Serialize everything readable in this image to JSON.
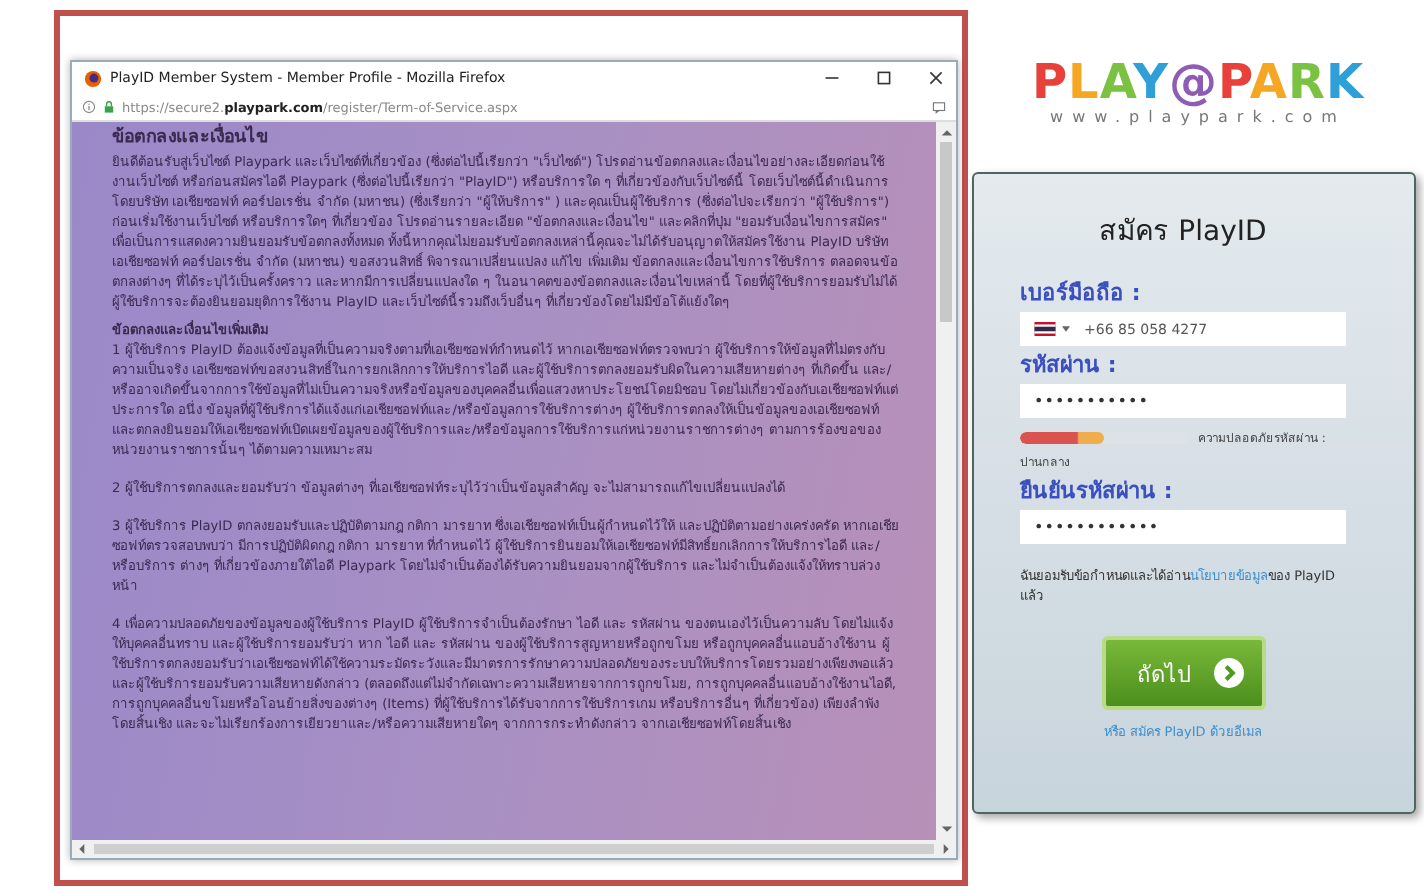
{
  "popup_window": {
    "title": "PlayID Member System - Member Profile - Mozilla Firefox",
    "url": "https://secure2.**playpark.com**/register/Term-of-Service.aspx",
    "terms": {
      "heading": "ข้อตกลงและเงื่อนไข",
      "intro": "ยินดีต้อนรับสู่เว็บไซต์ Playpark และเว็บไซต์ที่เกี่ยวข้อง (ซึ่งต่อไปนี้เรียกว่า \"เว็บไซต์\") โปรดอ่านข้อตกลงและเงื่อนไขอย่างละเอียดก่อนใช้งานเว็บไซต์ หรือก่อนสมัครไอดี Playpark (ซึ่งต่อไปนี้เรียกว่า \"PlayID\") หรือบริการใด ๆ ที่เกี่ยวข้องกับเว็บไซต์นี้ โดยเว็บไซต์นี้ดำเนินการโดยบริษัท เอเชียซอฟท์ คอร์ปอเรชั่น จำกัด (มหาชน) (ซึ่งเรียกว่า \"ผู้ให้บริการ\" ) และคุณเป็นผู้ใช้บริการ (ซึ่งต่อไปจะเรียกว่า \"ผู้ใช้บริการ\") ก่อนเริ่มใช้งานเว็บไซต์ หรือบริการใดๆ ที่เกี่ยวข้อง โปรดอ่านรายละเอียด \"ข้อตกลงและเงื่อนไข\" และคลิกที่ปุ่ม \"ยอมรับเงื่อนไขการสมัคร\" เพื่อเป็นการแสดงความยินยอมรับข้อตกลงทั้งหมด ทั้งนี้หากคุณไม่ยอมรับข้อตกลงเหล่านี้คุณจะไม่ได้รับอนุญาตให้สมัครใช้งาน PlayID บริษัท เอเชียซอฟท์ คอร์ปอเรชั่น จำกัด (มหาชน) ขอสงวนสิทธิ์ พิจารณาเปลี่ยนแปลง แก้ไข เพิ่มเติม ข้อตกลงและเงื่อนไขการใช้บริการ ตลอดจนข้อตกลงต่างๆ ที่ได้ระบุไว้เป็นครั้งคราว และหากมีการเปลี่ยนแปลงใด ๆ ในอนาคตของข้อตกลงและเงื่อนไขเหล่านี้ โดยที่ผู้ใช้บริการยอมรับไม่ได้ ผู้ใช้บริการจะต้องยินยอมยุติการใช้งาน PlayID และเว็บไซต์นี้รวมถึงเว็บอื่นๆ ที่เกี่ยวข้องโดยไม่มีข้อโต้แย้งใดๆ",
      "subheading": "ข้อตกลงและเงื่อนไขเพิ่มเติม",
      "clauses": [
        "1 ผู้ใช้บริการ PlayID ต้องแจ้งข้อมูลที่เป็นความจริงตามที่เอเชียซอฟท์กำหนดไว้ หากเอเชียซอฟท์ตรวจพบว่า ผู้ใช้บริการให้ข้อมูลที่ไม่ตรงกับความเป็นจริง เอเชียซอฟท์ขอสงวนสิทธิ์ในการยกเลิกการให้บริการไอดี และผู้ใช้บริการตกลงยอมรับผิดในความเสียหายต่างๆ ที่เกิดขึ้น และ/หรืออาจเกิดขึ้นจากการใช้ข้อมูลที่ไม่เป็นความจริงหรือข้อมูลของบุคคลอื่นเพื่อแสวงหาประโยชน์โดยมิชอบ โดยไม่เกี่ยวข้องกับเอเชียซอฟท์แต่ประการใด อนึ่ง ข้อมูลที่ผู้ใช้บริการได้แจ้งแก่เอเชียซอฟท์และ/หรือข้อมูลการใช้บริการต่างๆ ผู้ใช้บริการตกลงให้เป็นข้อมูลของเอเชียซอฟท์และตกลงยินยอมให้เอเชียซอฟท์เปิดเผยข้อมูลของผู้ใช้บริการและ/หรือข้อมูลการใช้บริการแก่หน่วยงานราชการต่างๆ ตามการร้องขอของหน่วยงานราชการนั้นๆ ได้ตามความเหมาะสม",
        "2 ผู้ใช้บริการตกลงและยอมรับว่า ข้อมูลต่างๆ ที่เอเชียซอฟท์ระบุไว้ว่าเป็นข้อมูลสำคัญ จะไม่สามารถแก้ไขเปลี่ยนแปลงได้",
        "3 ผู้ใช้บริการ PlayID ตกลงยอมรับและปฏิบัติตามกฎ กติกา มารยาท ซึ่งเอเชียซอฟท์เป็นผู้กำหนดไว้ให้ และปฏิบัติตามอย่างเคร่งครัด หากเอเชียซอฟท์ตรวจสอบพบว่า มีการปฏิบัติผิดกฎ กติกา มารยาท ที่กำหนดไว้ ผู้ใช้บริการยินยอมให้เอเชียซอฟท์มีสิทธิ์ยกเลิกการให้บริการไอดี และ/หรือบริการ ต่างๆ ที่เกี่ยวข้องภายใต้ไอดี Playpark โดยไม่จำเป็นต้องได้รับความยินยอมจากผู้ใช้บริการ และไม่จำเป็นต้องแจ้งให้ทราบล่วงหน้า",
        "4 เพื่อความปลอดภัยของข้อมูลของผู้ใช้บริการ PlayID ผู้ใช้บริการจำเป็นต้องรักษา ไอดี และ รหัสผ่าน ของตนเองไว้เป็นความลับ โดยไม่แจ้งให้บุคคลอื่นทราบ และผู้ใช้บริการยอมรับว่า หาก ไอดี และ รหัสผ่าน ของผู้ใช้บริการสูญหายหรือถูกขโมย หรือถูกบุคคลอื่นแอบอ้างใช้งาน ผู้ใช้บริการตกลงยอมรับว่าเอเชียซอฟท์ได้ใช้ความระมัดระวังและมีมาตรการรักษาความปลอดภัยของระบบให้บริการโดยรวมอย่างเพียงพอแล้ว และผู้ใช้บริการยอมรับความเสียหายดังกล่าว (ตลอดถึงแต่ไม่จำกัดเฉพาะความเสียหายจากการถูกขโมย, การถูกบุคคลอื่นแอบอ้างใช้งานไอดี, การถูกบุคคลอื่นขโมยหรือโอนย้ายสิ่งของต่างๆ (Items) ที่ผู้ใช้บริการได้รับจากการใช้บริการเกม หรือบริการอื่นๆ ที่เกี่ยวข้อง) เพียงลำพังโดยสิ้นเชิง และจะไม่เรียกร้องการเยียวยาและ/หรือความเสียหายใดๆ จากการกระทำดังกล่าว จากเอเชียซอฟท์โดยสิ้นเชิง"
      ]
    }
  },
  "logo": {
    "words": [
      "PLAY",
      "@",
      "PARK"
    ],
    "tagline": "www.playpark.com"
  },
  "signup": {
    "title": "สมัคร PlayID",
    "fields": [
      {
        "kind": "phone",
        "label": "เบอร์มือถือ :",
        "value": "+66 85 058 4277"
      },
      {
        "kind": "password",
        "label": "รหัสผ่าน :",
        "value": "•••••••••••"
      },
      {
        "kind": "password",
        "label": "ยืนยันรหัสผ่าน :",
        "value": "••••••••••••"
      }
    ],
    "strength": {
      "level": 0.5,
      "label": "ความปลอดภัยรหัสผ่าน :",
      "rating": "ปานกลาง"
    },
    "agreement": {
      "before": "ฉันยอมรับข้อกำหนดและได้อ่าน",
      "link": "นโยบายข้อมูล",
      "after": "ของ PlayID แล้ว"
    },
    "next_button": "ถัดไป",
    "alt_link": "หรือ สมัคร PlayID ด้วยอีเมล"
  }
}
